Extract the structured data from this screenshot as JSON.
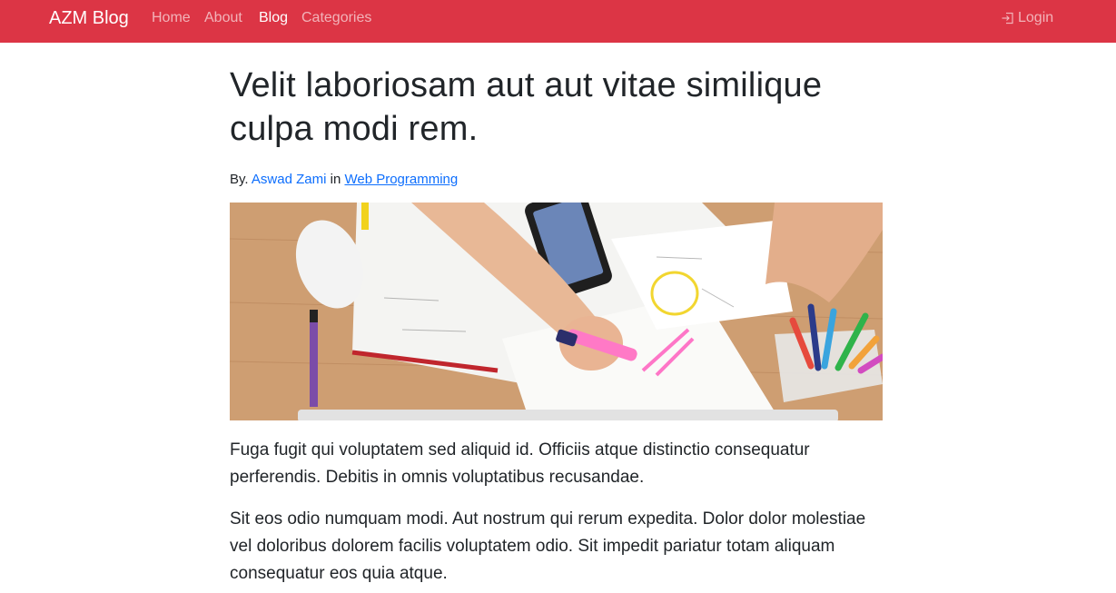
{
  "navbar": {
    "brand": "AZM Blog",
    "links": [
      {
        "label": "Home",
        "active": false
      },
      {
        "label": "About",
        "active": false
      },
      {
        "label": "Blog",
        "active": true
      },
      {
        "label": "Categories",
        "active": false
      }
    ],
    "login_label": "Login",
    "login_icon": "box-arrow-in-right-icon",
    "background_color": "#dc3545"
  },
  "post": {
    "title": "Velit laboriosam aut aut vitae similique culpa modi rem.",
    "meta_prefix": "By.",
    "author": "Aswad Zami",
    "meta_in": "in",
    "category": "Web Programming",
    "image_description": "desk with papers, smartphone, highlighter pens and pencil cup",
    "paragraphs": [
      "Fuga fugit qui voluptatem sed aliquid id. Officiis atque distinctio consequatur perferendis. Debitis in omnis voluptatibus recusandae.",
      "Sit eos odio numquam modi. Aut nostrum qui rerum expedita. Dolor dolor molestiae vel doloribus dolorem facilis voluptatem odio. Sit impedit pariatur totam aliquam consequatur eos quia atque."
    ]
  }
}
